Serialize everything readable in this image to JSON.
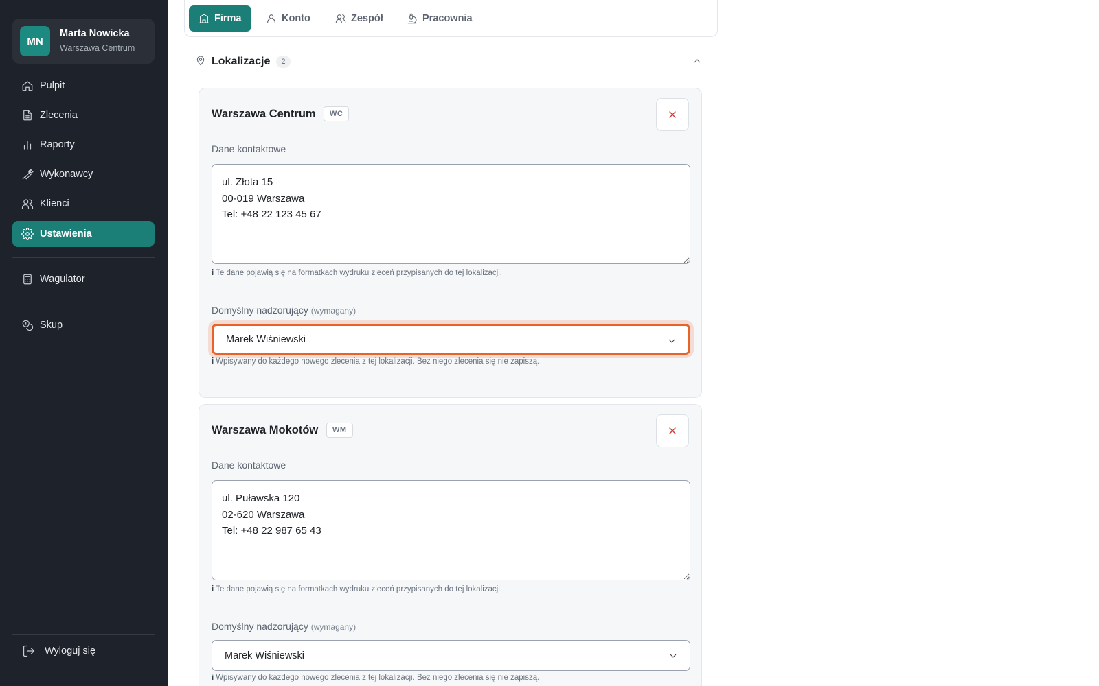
{
  "user": {
    "initials": "MN",
    "name": "Marta Nowicka",
    "location": "Warszawa Centrum"
  },
  "nav": {
    "items": [
      {
        "label": "Pulpit",
        "icon": "home-icon"
      },
      {
        "label": "Zlecenia",
        "icon": "document-icon"
      },
      {
        "label": "Raporty",
        "icon": "bar-chart-icon"
      },
      {
        "label": "Wykonawcy",
        "icon": "wrench-icon"
      },
      {
        "label": "Klienci",
        "icon": "users-icon"
      },
      {
        "label": "Ustawienia",
        "icon": "gear-icon",
        "active": true
      }
    ],
    "extra": [
      {
        "label": "Wagulator",
        "icon": "calculator-icon"
      },
      {
        "label": "Skup",
        "icon": "coins-icon"
      }
    ],
    "logout": "Wyloguj się"
  },
  "tabs": [
    {
      "label": "Firma",
      "icon": "building-icon",
      "active": true
    },
    {
      "label": "Konto",
      "icon": "user-icon"
    },
    {
      "label": "Zespół",
      "icon": "team-icon"
    },
    {
      "label": "Pracownia",
      "icon": "microscope-icon"
    }
  ],
  "section": {
    "title": "Lokalizacje",
    "count": "2"
  },
  "locations": [
    {
      "name": "Warszawa Centrum",
      "code": "WC",
      "contact_label": "Dane kontaktowe",
      "contact": "ul. Złota 15\n00-019 Warszawa\nTel: +48 22 123 45 67",
      "contact_hint_icon": "i",
      "contact_hint": "Te dane pojawią się na formatkach wydruku zleceń przypisanych do tej lokalizacji.",
      "supervisor_label": "Domyślny nadzorujący",
      "supervisor_required": "(wymagany)",
      "supervisor": "Marek Wiśniewski",
      "supervisor_hint_icon": "i",
      "supervisor_hint": "Wpisywany do każdego nowego zlecenia z tej lokalizacji. Bez niego zlecenia się nie zapiszą."
    },
    {
      "name": "Warszawa Mokotów",
      "code": "WM",
      "contact_label": "Dane kontaktowe",
      "contact": "ul. Puławska 120\n02-620 Warszawa\nTel: +48 22 987 65 43",
      "contact_hint_icon": "i",
      "contact_hint": "Te dane pojawią się na formatkach wydruku zleceń przypisanych do tej lokalizacji.",
      "supervisor_label": "Domyślny nadzorujący",
      "supervisor_required": "(wymagany)",
      "supervisor": "Marek Wiśniewski",
      "supervisor_hint_icon": "i",
      "supervisor_hint": "Wpisywany do każdego nowego zlecenia z tej lokalizacji. Bez niego zlecenia się nie zapiszą."
    }
  ],
  "colors": {
    "accent": "#1b7f78",
    "sidebar": "#1e222a",
    "focus": "#e8632a",
    "danger": "#c73a2e"
  }
}
